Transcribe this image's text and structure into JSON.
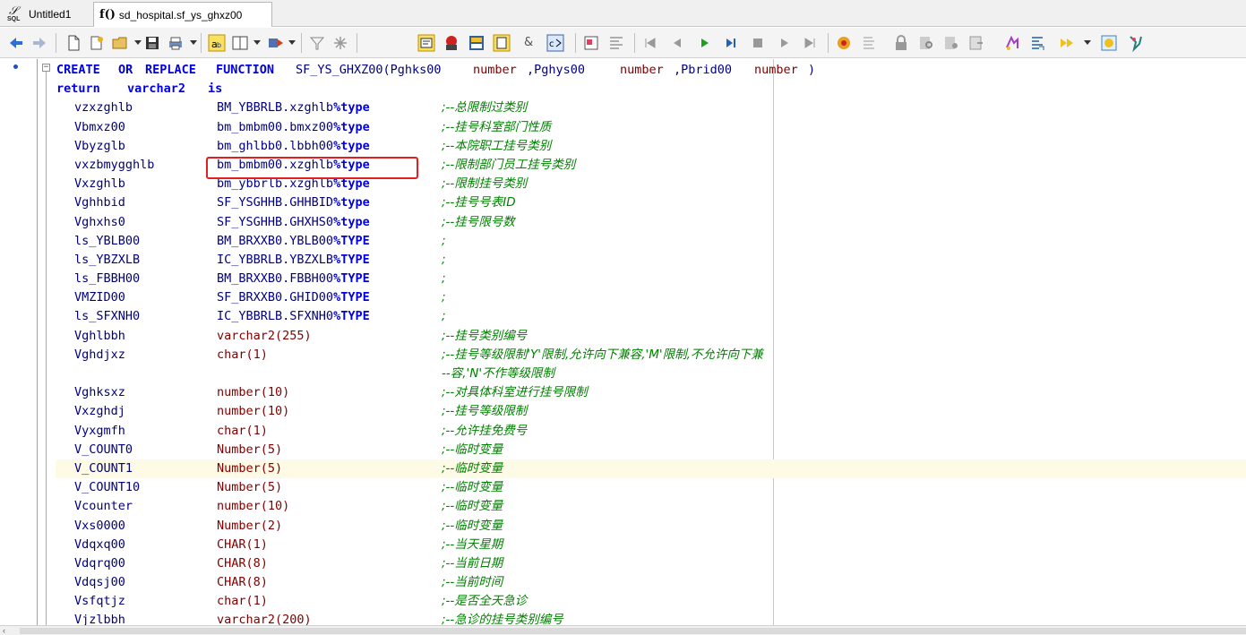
{
  "tabs": [
    {
      "label": "Untitled1",
      "icon": "sql-window-icon",
      "active": false
    },
    {
      "label": "sd_hospital.sf_ys_ghxz00",
      "icon": "function-icon",
      "active": true
    }
  ],
  "toolbar_icons": [
    "back-icon",
    "forward-icon",
    "new-icon",
    "open-icon",
    "open-dropdown-icon",
    "save-icon",
    "print-icon",
    "print-dropdown-icon",
    "font-icon",
    "layout-icon",
    "layout-dropdown-icon",
    "tools-icon",
    "tools-dropdown-icon",
    "filter-icon",
    "clear-filter-icon",
    "execute-icon",
    "debug-icon",
    "grid-icon",
    "schema-icon",
    "ampersand-icon",
    "compile-icon",
    "format-icon",
    "align-icon",
    "first-icon",
    "prev-icon",
    "run-icon",
    "step-icon",
    "stop-icon",
    "next-icon",
    "last-icon",
    "breakpoint-icon",
    "stack-icon",
    "lock-icon",
    "search-icon",
    "zoom-icon",
    "export-icon",
    "refresh-icon",
    "script-icon",
    "macro-icon",
    "macro-dropdown-icon",
    "help-icon",
    "plugin-icon"
  ],
  "editor": {
    "header_line": {
      "kw1": "CREATE",
      "kw2": "OR",
      "kw3": "REPLACE",
      "kw4": "FUNCTION",
      "name": "SF_YS_GHXZ00(Pghks00",
      "t1": "number",
      "p2": ",Pghys00",
      "t2": "number",
      "p3": ",Pbrid00",
      "t3": "number",
      "close": ")"
    },
    "return_line": {
      "kw": "return",
      "type": "varchar2",
      "is": "is"
    },
    "lines": [
      {
        "name": "vzxzghlb",
        "type": "BM_YBBRLB.xzghlb",
        "attr": "%type",
        "comment": ";--总限制过类别"
      },
      {
        "name": "Vbmxz00",
        "type": "bm_bmbm00.bmxz00",
        "attr": "%type",
        "comment": ";--挂号科室部门性质"
      },
      {
        "name": "Vbyzglb",
        "type": "bm_ghlbb0.lbbh00",
        "attr": "%type",
        "comment": ";--本院职工挂号类别"
      },
      {
        "name": "vxzbmygghlb",
        "type": "bm_bmbm00.xzghlb",
        "attr": "%type",
        "comment": ";--限制部门员工挂号类别"
      },
      {
        "name": "Vxzghlb",
        "type": "bm_ybbrlb.xzghlb",
        "attr": "%type",
        "comment": ";--限制挂号类别"
      },
      {
        "name": "Vghhbid",
        "type": "SF_YSGHHB.GHHBID",
        "attr": "%type",
        "comment": ";--挂号号表ID"
      },
      {
        "name": "Vghxhs0",
        "type": "SF_YSGHHB.GHXHS0",
        "attr": "%type",
        "comment": ";--挂号限号数"
      },
      {
        "name": "ls_YBLB00",
        "type": "BM_BRXXB0.YBLB00",
        "attr": "%TYPE",
        "comment": ";"
      },
      {
        "name": "ls_YBZXLB",
        "type": "IC_YBBRLB.YBZXLB",
        "attr": "%TYPE",
        "comment": ";"
      },
      {
        "name": "ls_FBBH00",
        "type": "BM_BRXXB0.FBBH00",
        "attr": "%TYPE",
        "comment": ";"
      },
      {
        "name": "VMZID00",
        "type": "SF_BRXXB0.GHID00",
        "attr": "%TYPE",
        "comment": ";"
      },
      {
        "name": "ls_SFXNH0",
        "type": "IC_YBBRLB.SFXNH0",
        "attr": "%TYPE",
        "comment": ";"
      },
      {
        "name": "Vghlbbh",
        "type": "varchar2",
        "attr": "(255)",
        "comment": ";--挂号类别编号"
      },
      {
        "name": "Vghdjxz",
        "type": "char",
        "attr": "(1)",
        "comment": ";--挂号等级限制'Y'限制,允许向下兼容,'M'限制,不允许向下兼"
      },
      {
        "name": "",
        "type": "",
        "attr": "",
        "comment": "--容,'N'不作等级限制"
      },
      {
        "name": "Vghksxz",
        "type": "number",
        "attr": "(10)",
        "comment": ";--对具体科室进行挂号限制"
      },
      {
        "name": "Vxzghdj",
        "type": "number",
        "attr": "(10)",
        "comment": ";--挂号等级限制"
      },
      {
        "name": "Vyxgmfh",
        "type": "char",
        "attr": "(1)",
        "comment": ";--允许挂免费号"
      },
      {
        "name": "V_COUNT0",
        "type": "Number",
        "attr": "(5)",
        "comment": ";--临时变量"
      },
      {
        "name": "V_COUNT1",
        "type": "Number",
        "attr": "(5)",
        "comment": ";--临时变量"
      },
      {
        "name": "V_COUNT10",
        "type": "Number",
        "attr": "(5)",
        "comment": ";--临时变量"
      },
      {
        "name": "Vcounter",
        "type": "number",
        "attr": "(10)",
        "comment": ";--临时变量"
      },
      {
        "name": "Vxs0000",
        "type": "Number",
        "attr": "(2)",
        "comment": ";--临时变量"
      },
      {
        "name": "Vdqxq00",
        "type": "CHAR",
        "attr": "(1)",
        "comment": ";--当天星期"
      },
      {
        "name": "Vdqrq00",
        "type": "CHAR",
        "attr": "(8)",
        "comment": ";--当前日期"
      },
      {
        "name": "Vdqsj00",
        "type": "CHAR",
        "attr": "(8)",
        "comment": ";--当前时间"
      },
      {
        "name": "Vsfqtjz",
        "type": "char",
        "attr": "(1)",
        "comment": ";--是否全天急诊"
      },
      {
        "name": "Vjzlbbh",
        "type": "varchar2",
        "attr": "(200)",
        "comment": ";--急诊的挂号类别编号"
      }
    ]
  },
  "colors": {
    "keyword": "#0000e0",
    "identifier": "#000080",
    "type": "#800000",
    "comment": "#008000",
    "highlight": "#e0201e",
    "current_line": "#fdfbe6"
  }
}
